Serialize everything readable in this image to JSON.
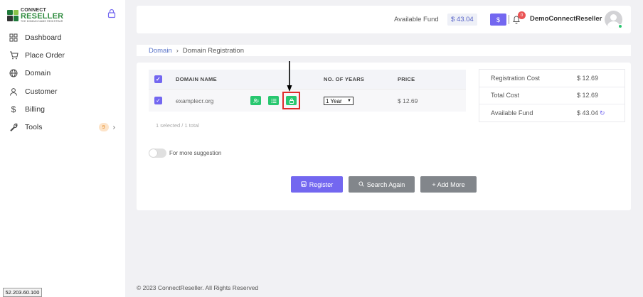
{
  "brand": {
    "line1": "CONNECT",
    "line2": "RESELLER",
    "line3": "THE DOMAIN NAME REGISTRAR"
  },
  "sidebar": {
    "items": [
      {
        "label": "Dashboard",
        "icon": "dashboard-icon"
      },
      {
        "label": "Place Order",
        "icon": "cart-icon"
      },
      {
        "label": "Domain",
        "icon": "globe-icon"
      },
      {
        "label": "Customer",
        "icon": "user-icon"
      },
      {
        "label": "Billing",
        "icon": "dollar-icon"
      },
      {
        "label": "Tools",
        "icon": "wrench-icon",
        "badge": "9"
      }
    ]
  },
  "ip_address": "52.203.60.100",
  "header": {
    "fund_label": "Available Fund",
    "fund_value": "$ 43.04",
    "fund_button": "$",
    "notification_count": "0",
    "user_name": "DemoConnectReseller"
  },
  "breadcrumb": {
    "parent": "Domain",
    "separator": "›",
    "current": "Domain Registration"
  },
  "table": {
    "headers": {
      "name": "DOMAIN NAME",
      "years": "NO. OF YEARS",
      "price": "PRICE"
    },
    "rows": [
      {
        "domain": "examplecr.org",
        "years": "1 Year",
        "price": "$ 12.69"
      }
    ],
    "selection_info": "1 selected / 1 total"
  },
  "suggestion_toggle": {
    "label": "For more suggestion",
    "enabled": false
  },
  "buttons": {
    "register": "Register",
    "search_again": "Search Again",
    "add_more": "+ Add More"
  },
  "summary": {
    "registration_cost_label": "Registration Cost",
    "registration_cost_value": "$ 12.69",
    "total_cost_label": "Total Cost",
    "total_cost_value": "$ 12.69",
    "available_fund_label": "Available Fund",
    "available_fund_value": "$ 43.04"
  },
  "footer": {
    "copyright": "© 2023 ConnectReseller. All Rights Reserved"
  },
  "colors": {
    "primary": "#7367f0",
    "success": "#28c76f",
    "secondary": "#82868b",
    "danger": "#ea5455",
    "highlight": "#e02b2b"
  }
}
